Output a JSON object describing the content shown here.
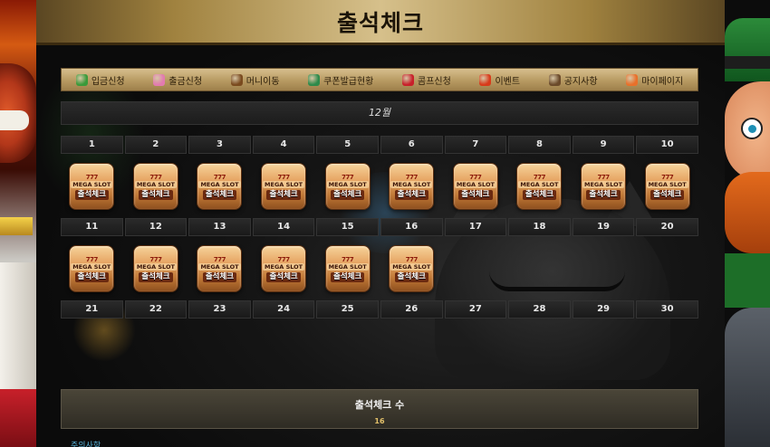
{
  "header": {
    "title": "출석체크"
  },
  "nav": {
    "items": [
      {
        "label": "입금신청",
        "icon": "money-bag-icon",
        "color": "#3a9a3a"
      },
      {
        "label": "출금신청",
        "icon": "donut-icon",
        "color": "#e27ab0"
      },
      {
        "label": "머니이동",
        "icon": "chest-icon",
        "color": "#7a4a1e"
      },
      {
        "label": "쿠폰발급현황",
        "icon": "gift-icon",
        "color": "#2d8a4a"
      },
      {
        "label": "콤프신청",
        "icon": "cherry-icon",
        "color": "#c8202a"
      },
      {
        "label": "이벤트",
        "icon": "star-icon",
        "color": "#d83a1a"
      },
      {
        "label": "공지사항",
        "icon": "scroll-icon",
        "color": "#6b4a2a"
      },
      {
        "label": "마이페이지",
        "icon": "fire-icon",
        "color": "#e8702a"
      }
    ]
  },
  "calendar": {
    "month": "12월",
    "rows": [
      {
        "days": [
          "1",
          "2",
          "3",
          "4",
          "5",
          "6",
          "7",
          "8",
          "9",
          "10"
        ],
        "stamps": 10
      },
      {
        "days": [
          "11",
          "12",
          "13",
          "14",
          "15",
          "16",
          "17",
          "18",
          "19",
          "20"
        ],
        "stamps": 6
      },
      {
        "days": [
          "21",
          "22",
          "23",
          "24",
          "25",
          "26",
          "27",
          "28",
          "29",
          "30"
        ],
        "stamps": 0
      }
    ],
    "stamp": {
      "top": "777",
      "brand": "MEGA SLOT",
      "label": "출석체크"
    }
  },
  "summary": {
    "label": "출석체크 수",
    "value": "16"
  },
  "notice": {
    "label": "주의사항"
  }
}
